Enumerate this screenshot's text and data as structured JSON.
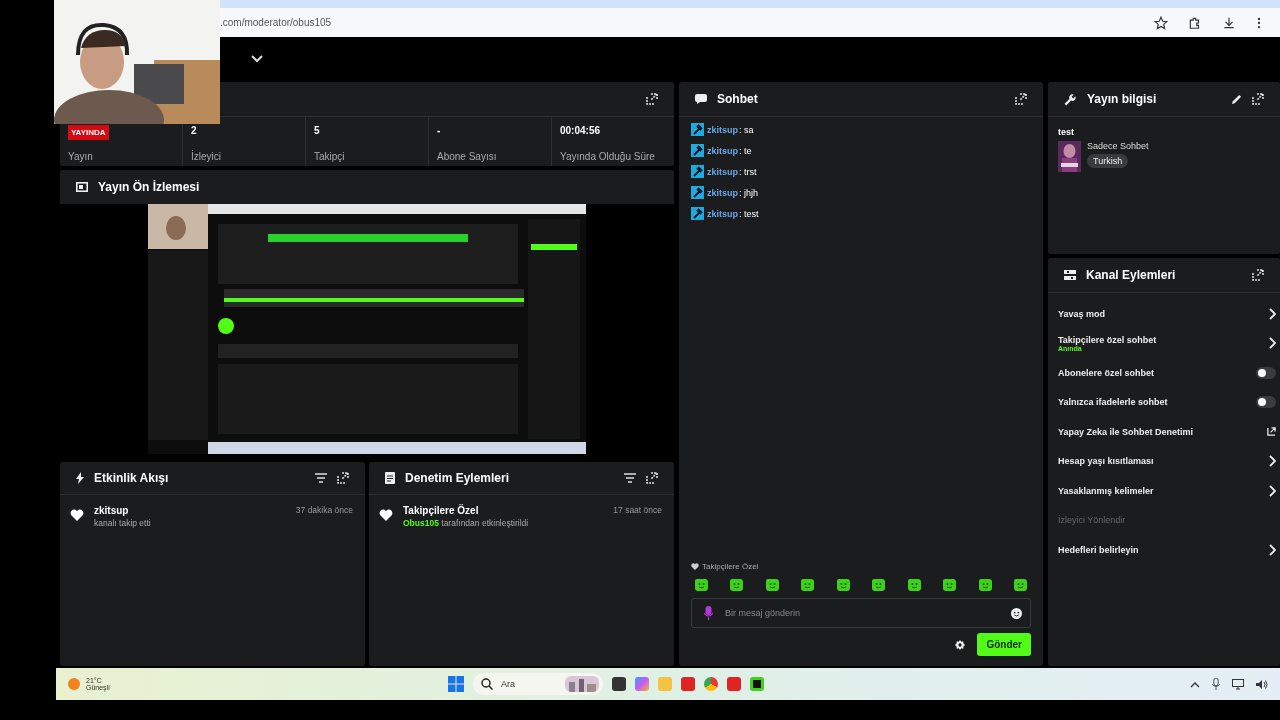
{
  "browser": {
    "url": ".com/moderator/obus105"
  },
  "stream": {
    "stats": [
      {
        "kind": "badge",
        "value": "YAYINDA",
        "label": "Yayın"
      },
      {
        "kind": "number",
        "value": "2",
        "label": "İzleyici"
      },
      {
        "kind": "number",
        "value": "5",
        "label": "Takipçi"
      },
      {
        "kind": "number",
        "value": "-",
        "label": "Abone Sayısı"
      },
      {
        "kind": "number",
        "value": "00:04:56",
        "label": "Yayında Olduğu Süre"
      }
    ]
  },
  "preview": {
    "title": "Yayın Ön İzlemesi"
  },
  "activity": {
    "title": "Etkinlik Akışı",
    "items": [
      {
        "user": "zkitsup",
        "text": "kanalı takip etti",
        "time": "37 dakika önce"
      }
    ]
  },
  "moderation": {
    "title": "Denetim Eylemleri",
    "items": [
      {
        "title": "Takipçilere Özel",
        "text": "**Obus105** tarafından etkinleştirildi",
        "time": "17 saat önce"
      }
    ]
  },
  "chat": {
    "title": "Sohbet",
    "messages": [
      {
        "user": "zkitsup",
        "text": ": sa"
      },
      {
        "user": "zkitsup",
        "text": ": te"
      },
      {
        "user": "zkitsup",
        "text": ": trst"
      },
      {
        "user": "zkitsup",
        "text": ": jhjh"
      },
      {
        "user": "zkitsup",
        "text": ": test"
      }
    ],
    "mode_label": "Takipçilere Özel",
    "placeholder": "Bir mesaj gönderin",
    "send": "Gönder"
  },
  "stream_info": {
    "title": "Yayın bilgisi",
    "stream_title": "test",
    "category": "Sadece Sohbet",
    "tags": [
      "Turkish"
    ]
  },
  "channel_actions": {
    "title": "Kanal Eylemleri",
    "items": [
      {
        "kind": "chevron",
        "label": "Yavaş mod",
        "disabled": false
      },
      {
        "kind": "chevron",
        "label": "Takipçilere özel sohbet",
        "sub": "Anında",
        "disabled": false
      },
      {
        "kind": "toggle",
        "label": "Abonelere özel sohbet",
        "on": false,
        "disabled": false
      },
      {
        "kind": "toggle",
        "label": "Yalnızca ifadelerle sohbet",
        "on": false,
        "disabled": false
      },
      {
        "kind": "external",
        "label": "Yapay Zeka ile Sohbet Denetimi",
        "disabled": false
      },
      {
        "kind": "chevron",
        "label": "Hesap yaşı kısıtlaması",
        "disabled": false
      },
      {
        "kind": "chevron",
        "label": "Yasaklanmış kelimeler",
        "disabled": false
      },
      {
        "kind": "plain",
        "label": "İzleyici Yönlendir",
        "disabled": true
      },
      {
        "kind": "chevron",
        "label": "Hedefleri belirleyin",
        "disabled": false
      }
    ]
  },
  "taskbar": {
    "temperature": "21°C",
    "weather": "Güneşli",
    "search": "Ara"
  }
}
